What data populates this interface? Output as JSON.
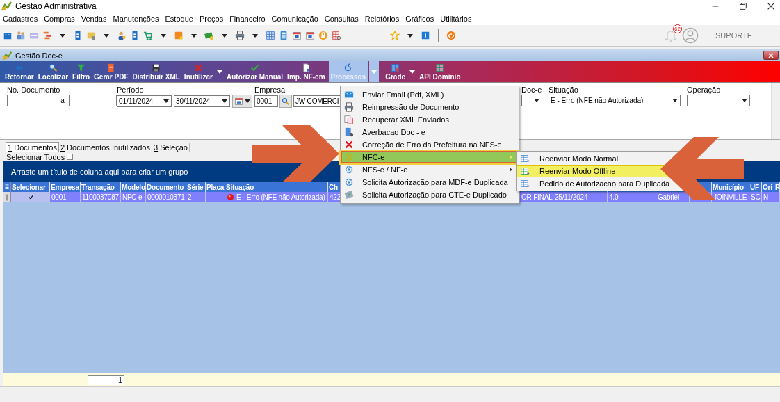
{
  "window": {
    "title": "Gestão Administrativa"
  },
  "menu_bar": [
    "Cadastros",
    "Compras",
    "Vendas",
    "Manutenções",
    "Estoque",
    "Preços",
    "Financeiro",
    "Comunicação",
    "Consultas",
    "Relatórios",
    "Gráficos",
    "Utilitários"
  ],
  "top_right": {
    "notification_count": "62",
    "user": "SUPORTE"
  },
  "document_window": {
    "title": "Gestão Doc-e"
  },
  "actions": [
    {
      "label": "Retornar",
      "selected": false,
      "dropdown": false
    },
    {
      "label": "Localizar",
      "selected": false,
      "dropdown": false
    },
    {
      "label": "Filtro",
      "selected": false,
      "dropdown": false
    },
    {
      "label": "Gerar PDF",
      "selected": false,
      "dropdown": false
    },
    {
      "label": "Distribuir XML",
      "selected": false,
      "dropdown": false
    },
    {
      "label": "Inutilizar",
      "selected": false,
      "dropdown": true
    },
    {
      "label": "Autorizar Manual",
      "selected": false,
      "dropdown": false
    },
    {
      "label": "Imp. NF-em",
      "selected": false,
      "dropdown": false
    },
    {
      "label": "Processos",
      "selected": true,
      "dropdown": true
    },
    {
      "label": "Grade",
      "selected": false,
      "dropdown": true
    },
    {
      "label": "API Dominio",
      "selected": false,
      "dropdown": false
    }
  ],
  "filters": {
    "document_number": {
      "label": "No. Documento",
      "separator": "a"
    },
    "period": {
      "label": "Período",
      "start": "01/11/2024",
      "end": "30/11/2024"
    },
    "company": {
      "label": "Empresa",
      "code": "0001",
      "name": "JW COMERCI"
    },
    "doc_type": {
      "label": "Doc-e"
    },
    "status": {
      "label": "Situação",
      "value": "E - Erro (NFE não Autorizada)"
    },
    "operation": {
      "label": "Operação"
    }
  },
  "tabs": [
    {
      "label": "1 Documentos",
      "selected": true
    },
    {
      "label": "2 Documentos Inutilizados",
      "selected": false
    },
    {
      "label": "3 Seleção",
      "selected": false
    }
  ],
  "select_all": {
    "label": "Selecionar Todos",
    "checked": false
  },
  "group_panel": "Arraste um título de coluna aqui para criar um grupo",
  "table": {
    "columns": [
      "Selecionar",
      "Empresa",
      "Transação",
      "Modelo",
      "Documento",
      "Série",
      "Placa",
      "Situação",
      "Ch",
      "",
      "",
      "",
      "",
      "",
      "Município",
      "UF",
      "Ori",
      "R"
    ],
    "rows": [
      {
        "selected": true,
        "checked": true,
        "cells": [
          "",
          "0001",
          "1100037087",
          "NFC-e",
          "0000010371",
          "2",
          "",
          "E - Erro (NFE não Autorizada)",
          "422",
          "OR FINAL",
          "25/11/2024",
          "4.0",
          "Gabriel",
          "",
          "JOINVILLE",
          "SC",
          "N",
          ""
        ]
      }
    ]
  },
  "footer": {
    "count": "1"
  },
  "context_menu": {
    "items": [
      {
        "label": "Enviar Email (Pdf, XML)",
        "selected": false,
        "submenu": false
      },
      {
        "label": "Reimpressão de Documento",
        "selected": false,
        "submenu": false
      },
      {
        "label": "Recuperar XML Enviados",
        "selected": false,
        "submenu": false
      },
      {
        "label": "Averbacao Doc - e",
        "selected": false,
        "submenu": false
      },
      {
        "label": "Correção de Erro da Prefeitura na NFS-e",
        "selected": false,
        "submenu": false
      },
      {
        "label": "NFC-e",
        "selected": true,
        "submenu": true
      },
      {
        "label": "NFS-e / NF-e",
        "selected": false,
        "submenu": true
      },
      {
        "label": "Solicita Autorização para MDF-e Duplicada",
        "selected": false,
        "submenu": false
      },
      {
        "label": "Solicita Autorização para CTE-e Duplicado",
        "selected": false,
        "submenu": false
      }
    ]
  },
  "submenu": {
    "items": [
      {
        "label": "Reenviar Modo Normal",
        "selected": false
      },
      {
        "label": "Reenviar Modo Offline",
        "selected": true
      },
      {
        "label": "Pedido de Autorizacao para Duplicada",
        "selected": false
      }
    ]
  }
}
